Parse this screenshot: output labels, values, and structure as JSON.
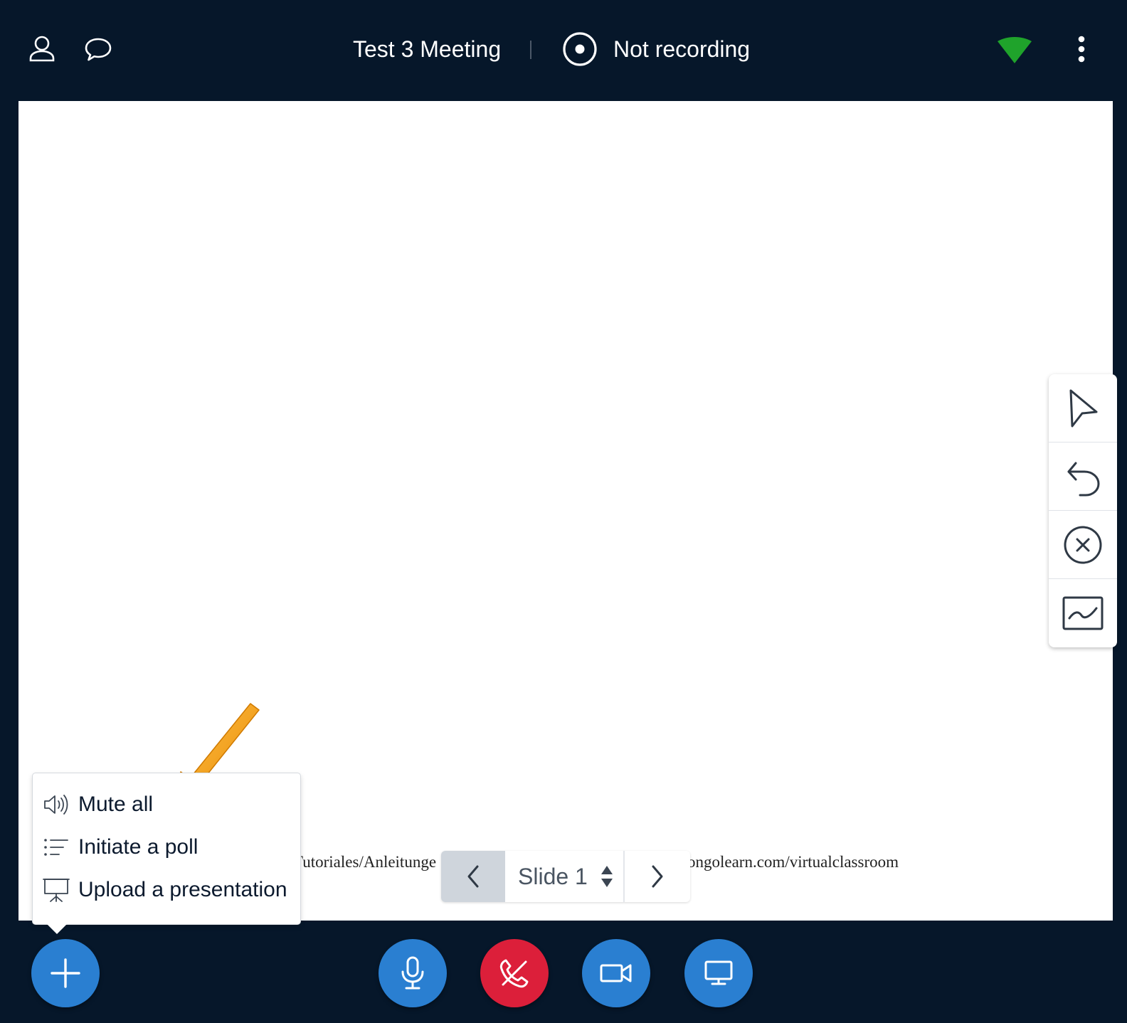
{
  "header": {
    "meeting_title": "Test 3 Meeting",
    "recording_label": "Not recording",
    "icons": {
      "users": "user-icon",
      "chat": "chat-icon",
      "recording": "record-icon",
      "connection": "connection-status-icon",
      "options": "more-options-icon"
    }
  },
  "colors": {
    "background": "#06172a",
    "canvas": "#ffffff",
    "primary_button": "#2a7fd1",
    "leave_button": "#dc1f3a",
    "connection_ok": "#1fa32b",
    "annotation_arrow": "#f39a12"
  },
  "slide": {
    "text_left": "Tutoriales/Anleitunge",
    "text_right": "ongolearn.com/virtualclassroom"
  },
  "slide_nav": {
    "current": "Slide 1",
    "prev_icon": "chevron-left-icon",
    "next_icon": "chevron-right-icon"
  },
  "annotation_tools": [
    {
      "name": "pointer-tool",
      "icon": "cursor-icon"
    },
    {
      "name": "undo-tool",
      "icon": "undo-icon"
    },
    {
      "name": "clear-tool",
      "icon": "clear-icon"
    },
    {
      "name": "whiteboard-tool",
      "icon": "whiteboard-icon"
    }
  ],
  "actions_menu": {
    "items": [
      {
        "label": "Mute all",
        "icon": "speaker-icon"
      },
      {
        "label": "Initiate a poll",
        "icon": "poll-list-icon"
      },
      {
        "label": "Upload a presentation",
        "icon": "presentation-icon"
      }
    ]
  },
  "bottom_bar": {
    "buttons": [
      {
        "name": "actions-button",
        "icon": "plus-icon"
      },
      {
        "name": "microphone-button",
        "icon": "microphone-icon"
      },
      {
        "name": "leave-audio-button",
        "icon": "phone-off-icon"
      },
      {
        "name": "camera-button",
        "icon": "video-camera-icon"
      },
      {
        "name": "screen-share-button",
        "icon": "desktop-icon"
      }
    ]
  }
}
